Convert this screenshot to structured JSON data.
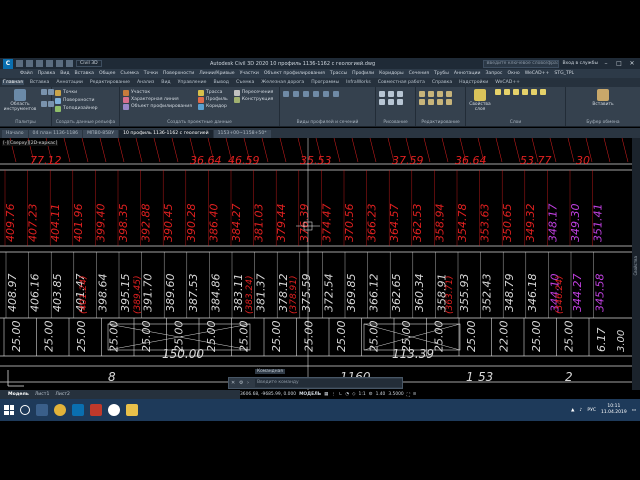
{
  "app": {
    "title": "Autodesk Civil 3D 2020    10 профиль 1136-1162 с геологией.dwg",
    "workspace": "Civil 3D",
    "search_placeholder": "Введите ключевое слово/фразу",
    "signin": "Вход в службы",
    "logo": "C"
  },
  "menu": [
    "Файл",
    "Правка",
    "Вид",
    "Вставка",
    "Общее",
    "Съемка",
    "Точки",
    "Поверхности",
    "Линии/Кривые",
    "Участки",
    "Объект профилирования",
    "Трассы",
    "Профили",
    "Коридоры",
    "Сечения",
    "Трубы",
    "Аннотации",
    "Запрос",
    "Окно",
    "WeCAD++",
    "STG_TPL"
  ],
  "ribbon_tabs": [
    "Главная",
    "Вставка",
    "Аннотации",
    "Редактирование",
    "Анализ",
    "Вид",
    "Управление",
    "Вывод",
    "Съемка",
    "Железная дорога",
    "Программы",
    "InfraWorks",
    "Совместная работа",
    "Справка",
    "Надстройки",
    "WeCAD++"
  ],
  "ribbon": {
    "tools": {
      "label": "Область инструментов",
      "title": "Палитры"
    },
    "create_ground": {
      "items": [
        "Точки",
        "Поверхности",
        "Топодизайнер"
      ],
      "title": "Создать данные рельефа"
    },
    "create_design": {
      "items": [
        "Участок",
        "Характерная линия",
        "Объект профилирования",
        "Трасса",
        "Профиль",
        "Коридор",
        "Пересечения",
        "Конструкция"
      ],
      "title": "Создать проектные данные"
    },
    "profile_views_title": "Виды профилей и сечений",
    "draw_title": "Рисование",
    "modify_title": "Редактирование",
    "layers_title": "Слои",
    "properties_label": "Свойства слоя",
    "insert_label": "Вставить",
    "clipboard_title": "Буфер обмена"
  },
  "file_tabs": [
    "Начало",
    "04 план 1136-1186",
    "МПВ0-85ВУ",
    "10 профиль 1136-1162 с геологией",
    "1153+00~1158+50*"
  ],
  "view_label": "[-][Сверху][2D-каркас]",
  "drawing": {
    "top_values": [
      "77.12",
      "36.64",
      "46.59",
      "35.53",
      "37.59",
      "36.64",
      "53.77",
      "30"
    ],
    "row1": [
      "409.76",
      "407.23",
      "404.11",
      "401.96",
      "399.40",
      "398.35",
      "392.88",
      "390.45",
      "390.28",
      "386.40",
      "384.27",
      "381.03",
      "379.44",
      "376.39",
      "374.47",
      "370.56",
      "366.23",
      "364.57",
      "362.53",
      "358.94",
      "354.78",
      "353.63",
      "350.65",
      "349.32",
      "348.17",
      "349.30",
      "351.41"
    ],
    "row2": [
      "408.97",
      "406.16",
      "403.85",
      "401.47",
      "398.64",
      "395.15",
      "391.70",
      "389.60",
      "387.53",
      "384.86",
      "383.11",
      "381.37",
      "378.12",
      "375.59",
      "372.54",
      "369.85",
      "366.12",
      "362.65",
      "360.34",
      "358.91",
      "355.93",
      "352.43",
      "348.79",
      "346.18",
      "344.10",
      "344.27",
      "345.58"
    ],
    "row2_sub": [
      "401.24",
      "389.45",
      "383.24",
      "378.91",
      "363.71",
      "346.24"
    ],
    "row3": [
      "25.00",
      "25.00",
      "25.00",
      "25.00",
      "25.00",
      "25.00",
      "25.00",
      "25.00",
      "25.00",
      "25.00",
      "25.00",
      "25.00",
      "25.00",
      "25.00",
      "25.00",
      "22.00",
      "25.00",
      "25.00",
      "6.17"
    ],
    "row3_extra": [
      "150.00",
      "113.39",
      "3.00"
    ],
    "bottom": [
      "8",
      "1160",
      "1",
      "53",
      "2"
    ]
  },
  "vertical_label": "Свойства",
  "command": {
    "label": "Командная",
    "placeholder": "Введите команду"
  },
  "layout_tabs": [
    "Модель",
    "Лист1",
    "Лист2"
  ],
  "status": {
    "coords": "3606.68, -9685.99, 0.000",
    "mode": "МОДЕЛЬ",
    "scale": "1:1",
    "lineweight": "1.40",
    "value": "3.5000",
    "lang": "РУС"
  },
  "clock": {
    "time": "10:11",
    "date": "11.04.2019"
  },
  "colors": {
    "red": "#e02020",
    "magenta": "#c040e0",
    "dim": "#d8d8d8"
  }
}
